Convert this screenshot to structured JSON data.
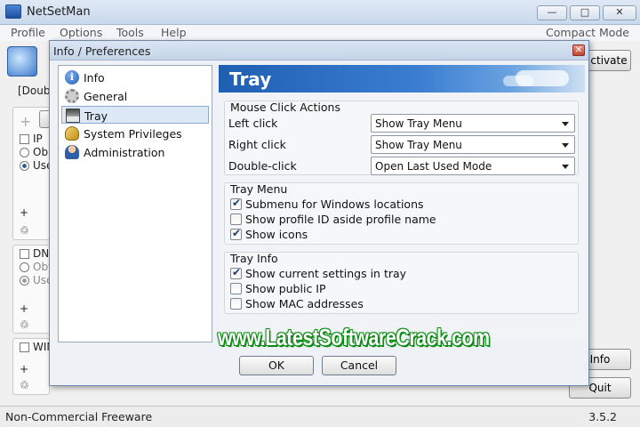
{
  "app": {
    "title": "NetSetMan",
    "window_buttons": {
      "minimize": "—",
      "maximize": "□",
      "close": "✕"
    }
  },
  "menubar": {
    "items": [
      "Profile",
      "Options",
      "Tools",
      "Help"
    ],
    "compact_mode": "Compact Mode"
  },
  "background": {
    "profile_label": "[Doubl",
    "activate_button": "ctivate",
    "info_button": "Info",
    "quit_button": "Quit",
    "ip_label": "IP",
    "ip_obtain": "Ob",
    "ip_use": "Use",
    "dns_label": "DNS",
    "dns_obtain": "Obt",
    "dns_use": "Use",
    "wins_label": "WIN"
  },
  "status_bar": {
    "license": "Non-Commercial Freeware",
    "version": "3.5.2"
  },
  "dialog": {
    "title": "Info / Preferences",
    "close_glyph": "✕",
    "nav": [
      {
        "label": "Info",
        "icon": "info-icon"
      },
      {
        "label": "General",
        "icon": "gear-icon"
      },
      {
        "label": "Tray",
        "icon": "tray-icon",
        "selected": true
      },
      {
        "label": "System Privileges",
        "icon": "key-icon"
      },
      {
        "label": "Administration",
        "icon": "user-icon"
      }
    ],
    "banner_title": "Tray",
    "mouse_actions": {
      "title": "Mouse Click Actions",
      "rows": [
        {
          "label": "Left click",
          "value": "Show Tray Menu"
        },
        {
          "label": "Right click",
          "value": "Show Tray Menu"
        },
        {
          "label": "Double-click",
          "value": "Open Last Used Mode"
        }
      ]
    },
    "tray_menu": {
      "title": "Tray Menu",
      "options": [
        {
          "label": "Submenu for Windows locations",
          "checked": true
        },
        {
          "label": "Show profile ID aside profile name",
          "checked": false
        },
        {
          "label": "Show icons",
          "checked": true
        }
      ]
    },
    "tray_info": {
      "title": "Tray Info",
      "options": [
        {
          "label": "Show current settings in tray",
          "checked": true
        },
        {
          "label": "Show public IP",
          "checked": false
        },
        {
          "label": "Show MAC addresses",
          "checked": false
        }
      ]
    },
    "ok_button": "OK",
    "cancel_button": "Cancel"
  },
  "watermark": "www.LatestSoftwareCrack.com"
}
